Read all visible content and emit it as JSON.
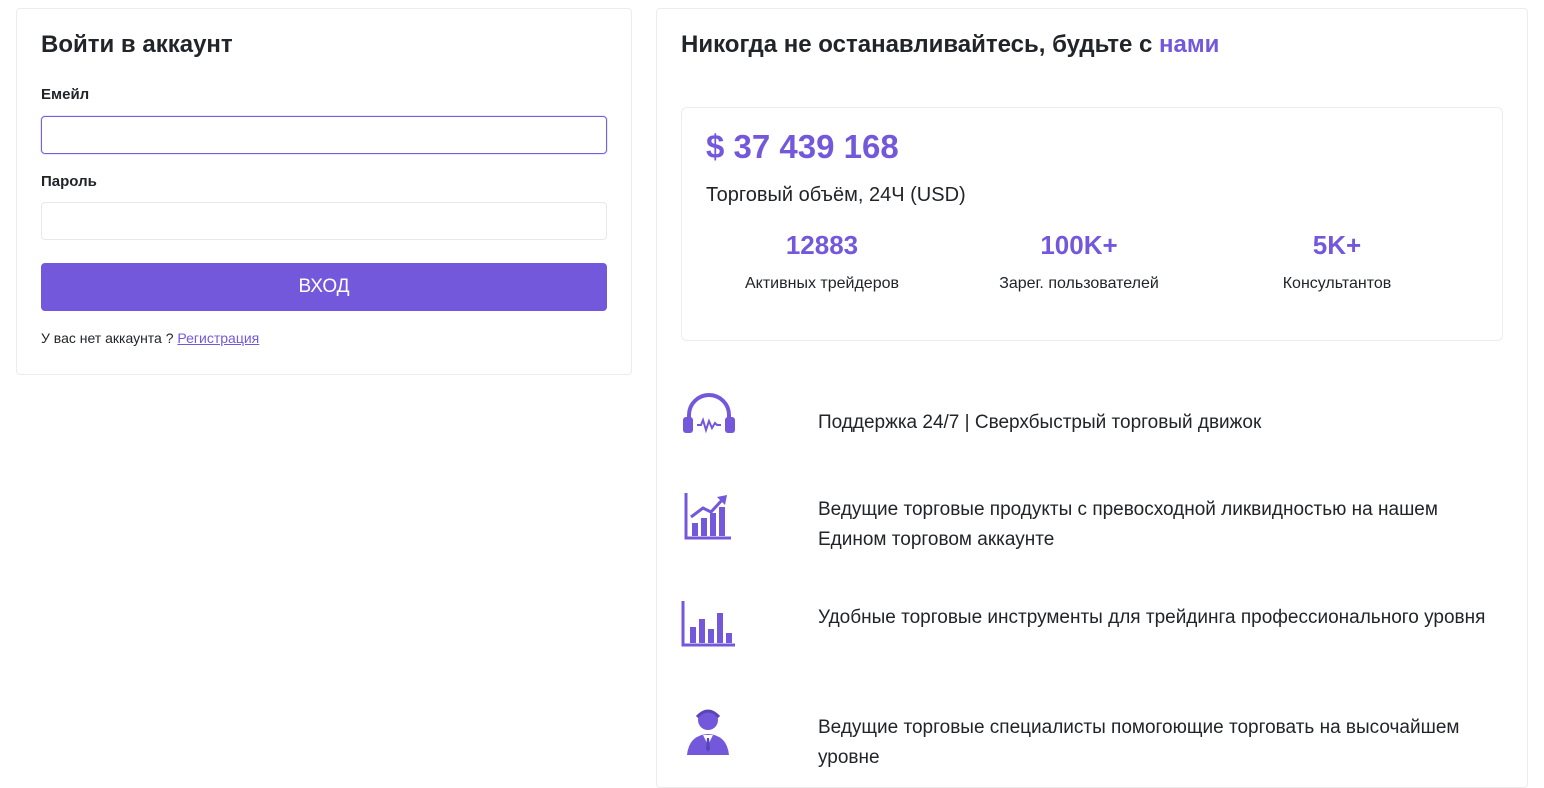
{
  "login": {
    "title": "Войти в аккаунт",
    "email_label": "Емейл",
    "email_value": "",
    "password_label": "Пароль",
    "password_value": "",
    "submit_label": "ВХОД",
    "no_account_text": "У вас нет аккаунта ?",
    "register_link": "Регистрация"
  },
  "promo": {
    "title_main": "Никогда не останавливайтесь, будьте с",
    "title_accent": "нами",
    "volume_value": "$ 37 439 168",
    "volume_label": "Торговый объём, 24Ч (USD)",
    "stats": [
      {
        "value": "12883",
        "label": "Активных трейдеров"
      },
      {
        "value": "100K+",
        "label": "Зарег. пользователей"
      },
      {
        "value": "5K+",
        "label": "Консультантов"
      }
    ],
    "features": [
      {
        "icon": "headset-icon",
        "text": "Поддержка 24/7 | Сверхбыстрый торговый движок"
      },
      {
        "icon": "growth-chart-icon",
        "text": "Ведущие торговые продукты с превосходной ликвидностью на нашем Едином торговом аккаунте"
      },
      {
        "icon": "bar-chart-icon",
        "text": "Удобные торговые инструменты для трейдинга профессионального уровня"
      },
      {
        "icon": "specialist-icon",
        "text": "Ведущие торговые специалисты помогоющие торговать на высочайшем уровне"
      }
    ]
  },
  "colors": {
    "accent": "#7458dc",
    "text": "#212529",
    "border": "#ececec"
  }
}
